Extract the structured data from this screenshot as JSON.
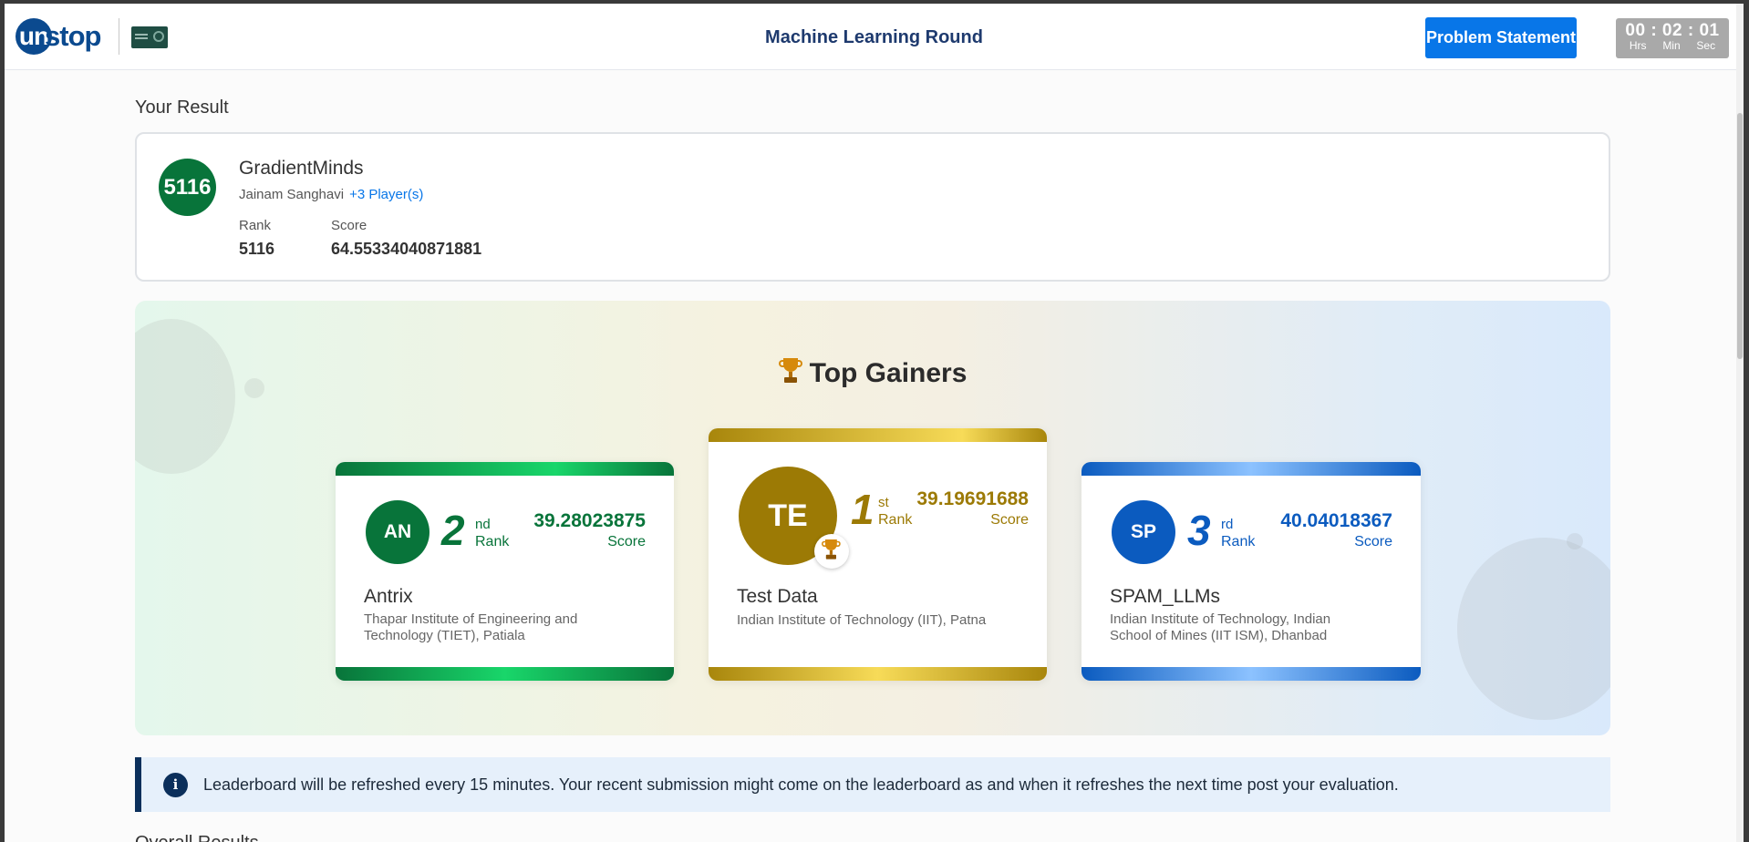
{
  "header": {
    "logo_mark": "un",
    "logo_text": "stop",
    "title": "Machine Learning Round",
    "problem_button": "Problem Statement",
    "timer": {
      "display": "00 : 02 : 01",
      "units": [
        "Hrs",
        "Min",
        "Sec"
      ]
    }
  },
  "result": {
    "section_title": "Your Result",
    "rank_badge": "5116",
    "team": "GradientMinds",
    "leader": "Jainam Sanghavi",
    "more_players": "+3 Player(s)",
    "rank_label": "Rank",
    "rank": "5116",
    "score_label": "Score",
    "score": "64.55334040871881"
  },
  "gainers": {
    "title": "Top Gainers",
    "cards": [
      {
        "initials": "AN",
        "place": "2",
        "suffix": "nd",
        "rank_label": "Rank",
        "score": "39.28023875",
        "score_label": "Score",
        "team": "Antrix",
        "institute": "Thapar Institute of Engineering and Technology (TIET), Patiala",
        "color": "#08743a"
      },
      {
        "initials": "TE",
        "place": "1",
        "suffix": "st",
        "rank_label": "Rank",
        "score": "39.19691688",
        "score_label": "Score",
        "team": "Test Data",
        "institute": "Indian Institute of Technology (IIT), Patna",
        "color": "#9c7a05"
      },
      {
        "initials": "SP",
        "place": "3",
        "suffix": "rd",
        "rank_label": "Rank",
        "score": "40.04018367",
        "score_label": "Score",
        "team": "SPAM_LLMs",
        "institute": "Indian Institute of Technology, Indian School of Mines (IIT ISM), Dhanbad",
        "color": "#0b5bbf"
      }
    ]
  },
  "notice": {
    "icon": "info-icon",
    "text": "Leaderboard will be refreshed every 15 minutes. Your recent submission might come on the leaderboard as and when it refreshes the next time post your evaluation."
  },
  "overall_title": "Overall Results"
}
